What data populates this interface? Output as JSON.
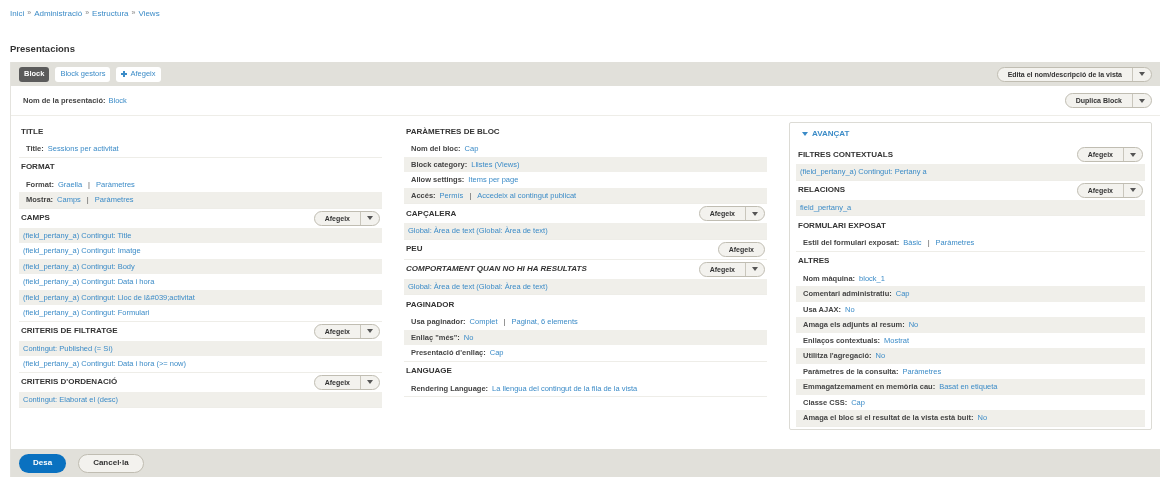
{
  "breadcrumb": [
    {
      "label": "Inici"
    },
    {
      "label": "Administració",
      "separator": "»"
    },
    {
      "label": "Estructura",
      "separator": "»"
    },
    {
      "label": "Views",
      "separator": "»"
    }
  ],
  "page_title": "Presentacions",
  "tabs": [
    {
      "label": "Block",
      "selected": true
    },
    {
      "label": "Block gestors",
      "selected": false
    }
  ],
  "add_display": {
    "label": "Afegeix"
  },
  "view_menu": {
    "label": "Edita el nom/descripció de la vista"
  },
  "display_name": {
    "label": "Nom de la presentació:",
    "value": "Block"
  },
  "duplicate_button": {
    "label": "Duplica Block"
  },
  "columns": [
    {
      "sections": [
        {
          "title": "TITLE",
          "italic": false,
          "rows": [
            {
              "label": "Title:",
              "value": "Sessions per activitat"
            }
          ]
        },
        {
          "title": "FORMAT",
          "italic": false,
          "rows": [
            {
              "label": "Format:",
              "value": "Graella",
              "separator": "|",
              "value_2": "Paràmetres"
            },
            {
              "label": "Mostra:",
              "value": "Camps",
              "separator": "|",
              "value_2": "Paràmetres"
            }
          ]
        },
        {
          "title": "CAMPS",
          "italic": false,
          "button": {
            "label": "Afegeix",
            "kind": "split"
          },
          "rows": [
            {
              "value": "(field_pertany_a) Contingut: Title"
            },
            {
              "value": "(field_pertany_a) Contingut: Imatge"
            },
            {
              "value": "(field_pertany_a) Contingut: Body"
            },
            {
              "value": "(field_pertany_a) Contingut: Data i hora"
            },
            {
              "value": "(field_pertany_a) Contingut: Lloc de l&#039;activitat"
            },
            {
              "value": "(field_pertany_a) Contingut: Formulari"
            }
          ]
        },
        {
          "title": "CRITERIS DE FILTRATGE",
          "italic": false,
          "button": {
            "label": "Afegeix",
            "kind": "split"
          },
          "rows": [
            {
              "value": "Contingut: Published (= Sí)"
            },
            {
              "value": "(field_pertany_a) Contingut: Data i hora (>= now)"
            }
          ]
        },
        {
          "title": "CRITERIS D'ORDENACIÓ",
          "italic": false,
          "button": {
            "label": "Afegeix",
            "kind": "split"
          },
          "rows": [
            {
              "value": "Contingut: Elaborat el (desc)"
            }
          ]
        }
      ]
    },
    {
      "sections": [
        {
          "title": "PARÀMETRES DE BLOC",
          "italic": false,
          "rows": [
            {
              "label": "Nom del bloc:",
              "value": "Cap"
            },
            {
              "label": "Block category:",
              "value": "Llistes (Views)"
            },
            {
              "label": "Allow settings:",
              "value": "Items per page"
            },
            {
              "label": "Accés:",
              "value": "Permís",
              "separator": "|",
              "value_2": "Accedeix al contingut publicat"
            }
          ]
        },
        {
          "title": "CAPÇALERA",
          "italic": false,
          "button": {
            "label": "Afegeix",
            "kind": "split"
          },
          "rows": [
            {
              "value": "Global: Àrea de text (Global: Àrea de text)"
            }
          ]
        },
        {
          "title": "PEU",
          "italic": false,
          "button": {
            "label": "Afegeix",
            "kind": "single"
          }
        },
        {
          "title": "COMPORTAMENT QUAN NO HI HA RESULTATS",
          "italic": true,
          "button": {
            "label": "Afegeix",
            "kind": "split"
          },
          "rows": [
            {
              "value": "Global: Àrea de text (Global: Àrea de text)"
            }
          ]
        },
        {
          "title": "PAGINADOR",
          "italic": false,
          "rows": [
            {
              "label": "Usa paginador:",
              "value": "Complet",
              "separator": "|",
              "value_2": "Paginat, 6 elements"
            },
            {
              "label": "Enllaç \"més\":",
              "value": "No"
            },
            {
              "label": "Presentació d'enllaç:",
              "value": "Cap"
            }
          ]
        },
        {
          "title": "LANGUAGE",
          "italic": false,
          "rows": [
            {
              "label": "Rendering Language:",
              "value": "La llengua del contingut de la fila de la vista"
            }
          ]
        }
      ]
    }
  ],
  "advanced": {
    "label": "AVANÇAT",
    "expanded": true,
    "sections": [
      {
        "title": "FILTRES CONTEXTUALS",
        "italic": false,
        "button": {
          "label": "Afegeix",
          "kind": "split"
        },
        "rows": [
          {
            "value": "(field_pertany_a) Contingut: Pertany a"
          }
        ]
      },
      {
        "title": "RELACIONS",
        "italic": false,
        "button": {
          "label": "Afegeix",
          "kind": "split"
        },
        "rows": [
          {
            "value": "field_pertany_a"
          }
        ]
      },
      {
        "title": "FORMULARI EXPOSAT",
        "italic": false,
        "rows": [
          {
            "label": "Estil del formulari exposat:",
            "value": "Bàsic",
            "separator": "|",
            "value_2": "Paràmetres"
          }
        ]
      },
      {
        "title": "ALTRES",
        "italic": false,
        "rows": [
          {
            "label": "Nom màquina:",
            "value": "block_1"
          },
          {
            "label": "Comentari administratiu:",
            "value": "Cap"
          },
          {
            "label": "Usa AJAX:",
            "value": "No"
          },
          {
            "label": "Amaga els adjunts al resum:",
            "value": "No"
          },
          {
            "label": "Enllaços contextuals:",
            "value": "Mostrat"
          },
          {
            "label": "Utilitza l'agregació:",
            "value": "No"
          },
          {
            "label": "Paràmetres de la consulta:",
            "value": "Paràmetres"
          },
          {
            "label": "Emmagatzemament en memòria cau:",
            "value": "Basat en etiqueta"
          },
          {
            "label": "Classe CSS:",
            "value": "Cap"
          },
          {
            "label": "Amaga el bloc si el resultat de la vista està buit:",
            "value": "No"
          }
        ]
      }
    ]
  },
  "actions": [
    {
      "label": "Desa",
      "kind": "primary"
    },
    {
      "label": "Cancel·la",
      "kind": "secondary"
    }
  ]
}
